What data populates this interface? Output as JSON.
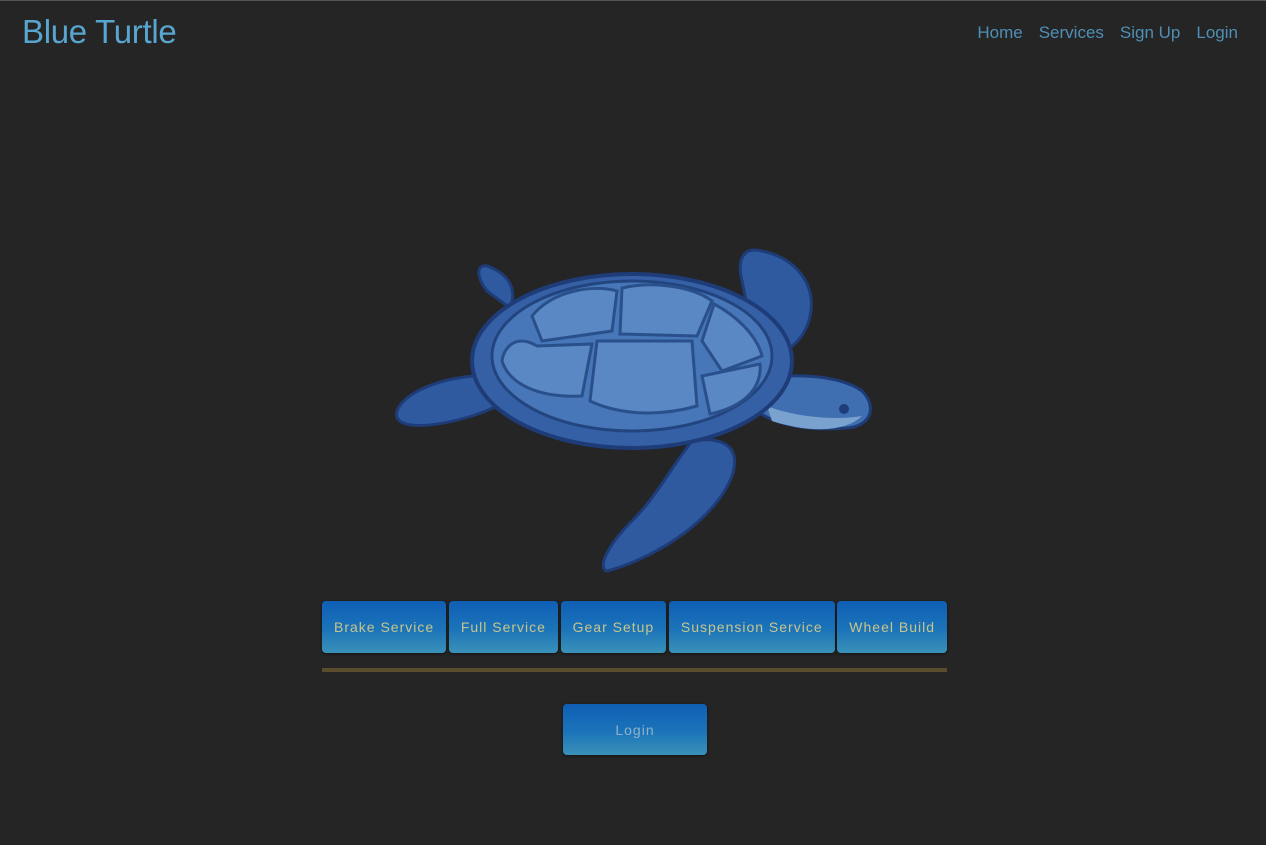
{
  "brand": {
    "title": "Blue Turtle"
  },
  "nav": {
    "items": [
      {
        "label": "Home"
      },
      {
        "label": "Services"
      },
      {
        "label": "Sign Up"
      },
      {
        "label": "Login"
      }
    ]
  },
  "hero": {
    "image_icon": "sea-turtle-illustration"
  },
  "services": {
    "buttons": [
      {
        "label": "Brake Service"
      },
      {
        "label": "Full Service"
      },
      {
        "label": "Gear Setup"
      },
      {
        "label": "Suspension Service"
      },
      {
        "label": "Wheel Build"
      }
    ]
  },
  "auth": {
    "login_label": "Login"
  },
  "colors": {
    "background": "#252525",
    "brand": "#58a6cf",
    "nav_link": "#4f8fb5",
    "button_top": "#0f5fb5",
    "button_bottom": "#3a91b8",
    "button_text": "#c9c58a",
    "divider": "#5a4d2e"
  }
}
